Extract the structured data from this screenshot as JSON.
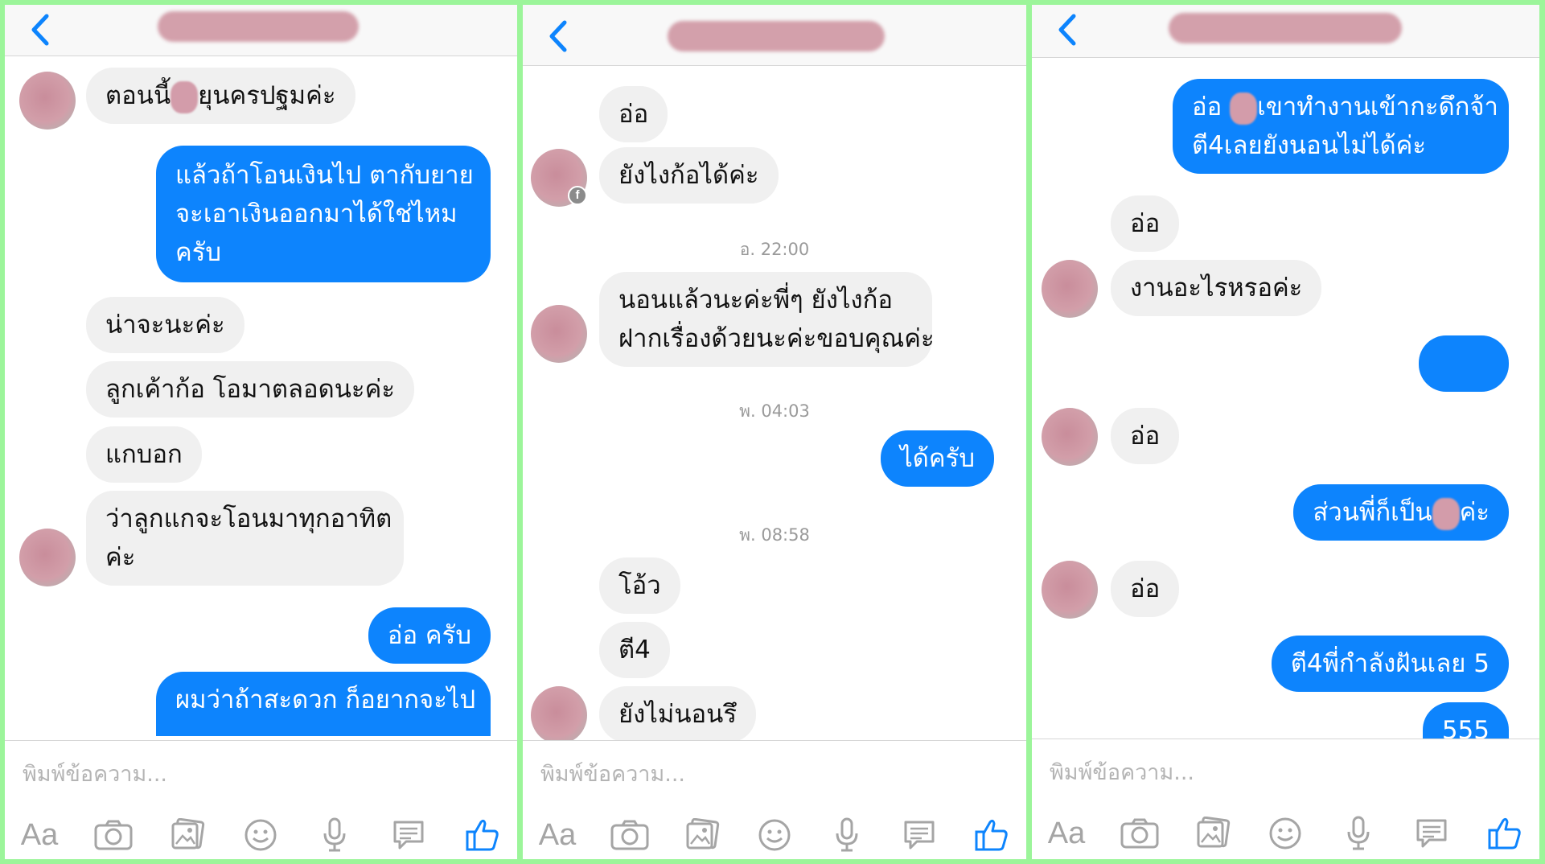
{
  "panels": [
    {
      "messages": [
        {
          "text": "ตอนนี้",
          "text_after": "ยุนครปฐมค่ะ"
        },
        {
          "lines": [
            "แล้วถ้าโอนเงินไป ตากับยาย",
            "จะเอาเงินออกมาได้ใช่ไหม",
            "ครับ"
          ]
        },
        {
          "text": "น่าจะนะค่ะ"
        },
        {
          "text": "ลูกเค้าก้อ โอมาตลอดนะค่ะ"
        },
        {
          "text": "แกบอก"
        },
        {
          "lines": [
            "ว่าลูกแกจะโอนมาทุกอาทิต",
            "ค่ะ"
          ]
        },
        {
          "text": "อ่อ ครับ"
        },
        {
          "text": "ผมว่าถ้าสะดวก ก็อยากจะไป"
        }
      ]
    },
    {
      "messages": [
        {
          "text": "อ่อ"
        },
        {
          "text": "ยังไงก้อได้ค่ะ"
        },
        {
          "timestamp": "อ. 22:00"
        },
        {
          "lines": [
            "นอนแล้วนะค่ะพี่ๆ ยังไงก้อ",
            "ฝากเรื่องด้วยนะค่ะขอบคุณค่ะ"
          ]
        },
        {
          "timestamp": "พ. 04:03"
        },
        {
          "text": "ได้ครับ"
        },
        {
          "timestamp": "พ. 08:58"
        },
        {
          "text": "โอ้ว"
        },
        {
          "text": "ตี4"
        },
        {
          "text": "ยังไม่นอนรึ"
        }
      ]
    },
    {
      "messages": [
        {
          "text": "อ่อ",
          "text_after": "เขาทำงานเข้ากะดึกจ้า",
          "line2": "ตี4เลยยังนอนไม่ได้ค่ะ"
        },
        {
          "text": "อ่อ"
        },
        {
          "text": "งานอะไรหรอค่ะ"
        },
        {
          "text": "อ่อ"
        },
        {
          "text": "ส่วนพี่ก็เป็น",
          "text_after": "ค่ะ"
        },
        {
          "text": "อ่อ"
        },
        {
          "text": "ตี4พี่กำลังฝันเลย 5"
        },
        {
          "text": "555"
        }
      ]
    }
  ],
  "composer": {
    "placeholder": "พิมพ์ข้อความ...",
    "text_button": "Aa"
  },
  "colors": {
    "outgoing_bubble": "#0d84fd",
    "incoming_bubble": "#f0f0f0",
    "accent": "#0d84fd",
    "frame": "#9cf59a"
  },
  "icons": [
    "back-chevron-icon",
    "camera-icon",
    "gallery-icon",
    "emoji-icon",
    "microphone-icon",
    "message-icon",
    "thumbs-up-icon"
  ]
}
